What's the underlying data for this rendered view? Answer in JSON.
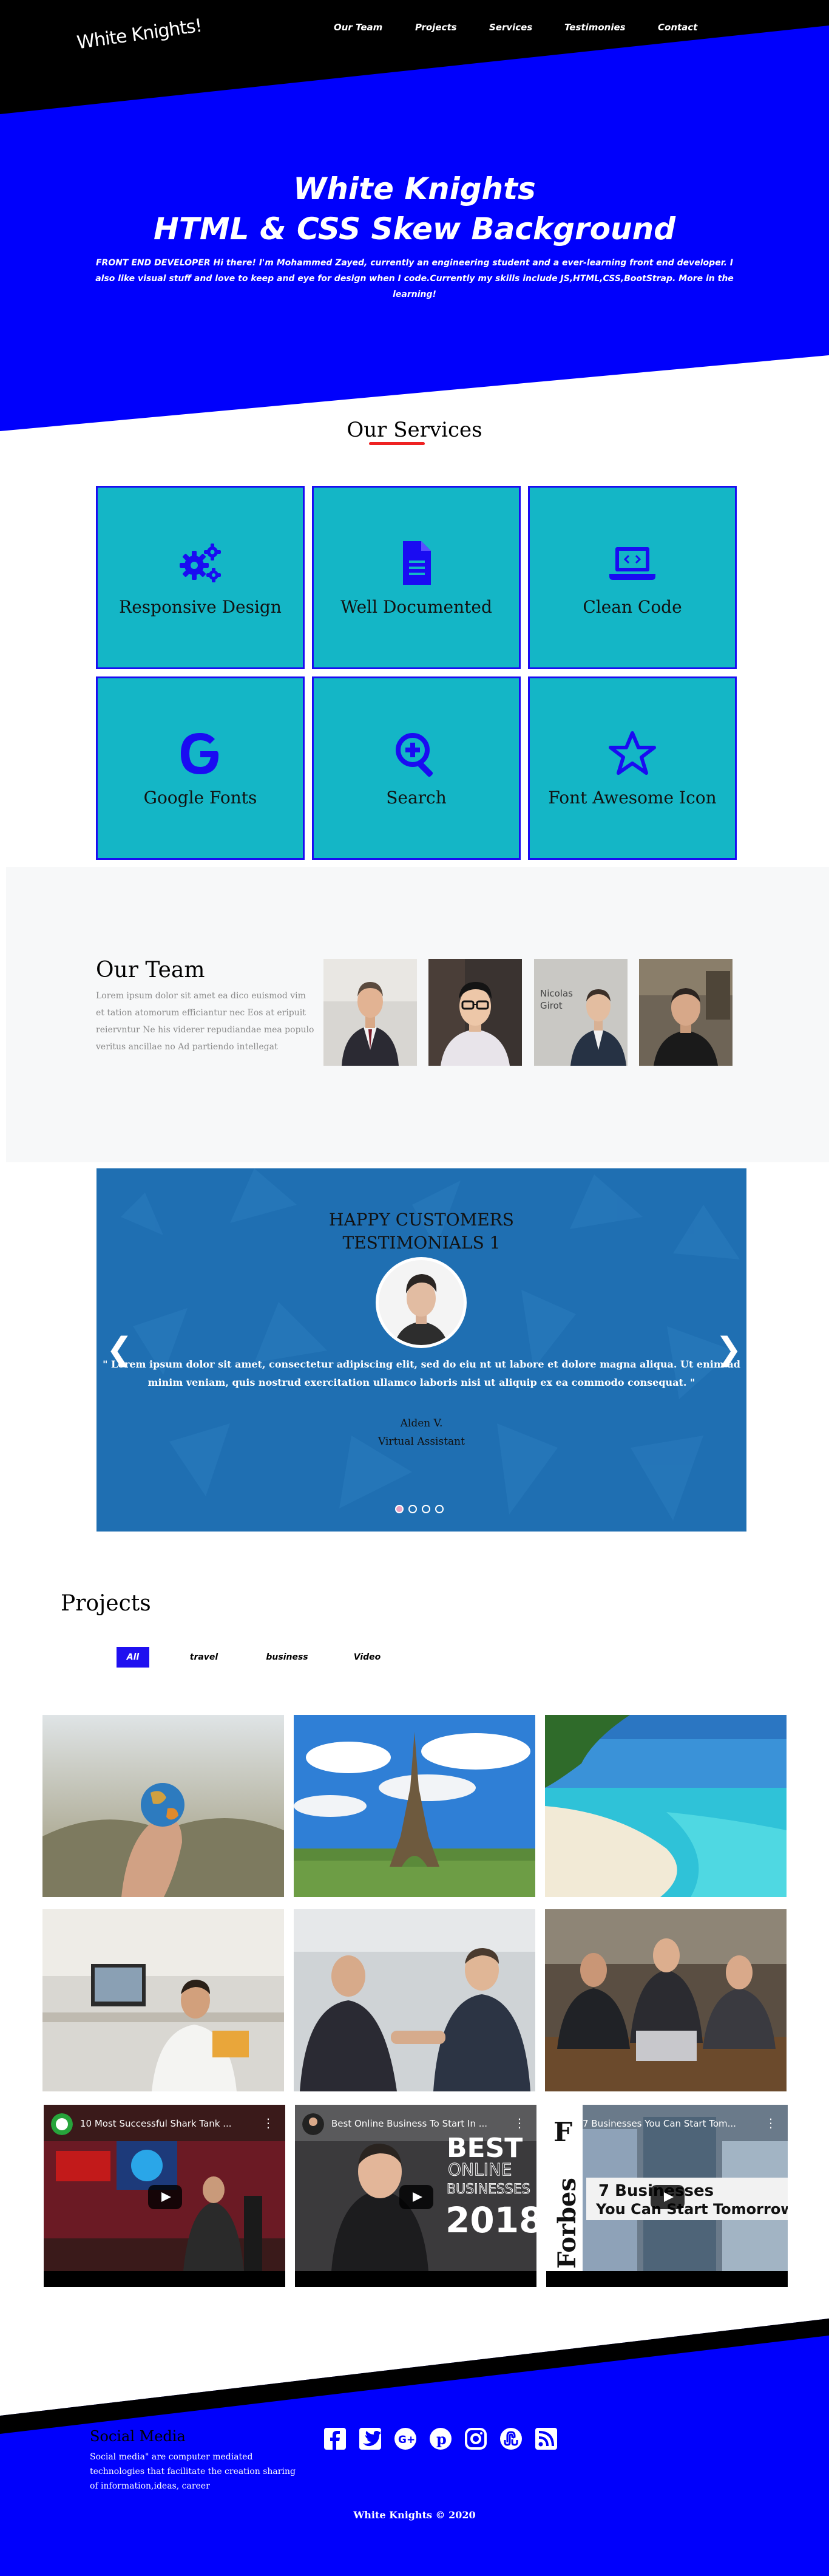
{
  "logo": "White Knights!",
  "nav": [
    "Our Team",
    "Projects",
    "Services",
    "Testimonies",
    "Contact"
  ],
  "hero": {
    "title": "White Knights",
    "subtitle": "HTML & CSS Skew Background",
    "description": "FRONT END DEVELOPER Hi there! I'm Mohammed Zayed, currently an engineering student and a ever-learning front end developer. I also like visual stuff and love to keep and eye for design when I code.Currently my skills include JS,HTML,CSS,BootStrap. More in the learning!"
  },
  "services": {
    "title": "Our Services",
    "items": [
      {
        "label": "Responsive Design",
        "icon": "cogs-icon"
      },
      {
        "label": "Well Documented",
        "icon": "file-icon"
      },
      {
        "label": "Clean Code",
        "icon": "laptop-code-icon"
      },
      {
        "label": "Google Fonts",
        "icon": "google-icon"
      },
      {
        "label": "Search",
        "icon": "search-plus-icon"
      },
      {
        "label": "Font Awesome Icon",
        "icon": "star-icon"
      }
    ],
    "accent": "#1a0cf2",
    "card_color": "#14b6c6"
  },
  "team": {
    "title": "Our Team",
    "text": "Lorem ipsum dolor sit amet ea dico euismod vim et tation atomorum efficiantur nec Eos at eripuit reiervntur Ne his viderer repudiandae mea populo veritus ancillae no Ad partiendo intellegat",
    "photo4_caption_1": "Nicolas",
    "photo4_caption_2": "Girot"
  },
  "testimonials": {
    "heading_1": "HAPPY CUSTOMERS",
    "heading_2": "TESTIMONIALS 1",
    "quote": "\" Lorem ipsum dolor sit amet, consectetur adipiscing elit, sed do eiu nt ut labore et dolore magna aliqua. Ut enim ad minim veniam, quis nostrud exercitation ullamco laboris nisi ut aliquip ex ea commodo consequat. \"",
    "name": "Alden V.",
    "role": "Virtual Assistant",
    "prev": "❮",
    "next": "❯",
    "slides": 4,
    "active_slide": 1
  },
  "projects": {
    "title": "Projects",
    "filters": [
      "All",
      "travel",
      "business",
      "Video"
    ],
    "active_filter": "All",
    "videos": [
      {
        "title": "10 Most Successful Shark Tank ..."
      },
      {
        "title": "Best Online Business To Start In ...",
        "overlay_1": "BEST",
        "overlay_2": "ONLINE",
        "overlay_3": "BUSINESSES",
        "overlay_4": "2018"
      },
      {
        "title": "7 Businesses You Can Start Tom...",
        "overlay_1": "7 Businesses",
        "overlay_2": "You Can Start Tomorrow",
        "brand": "Forbes"
      }
    ]
  },
  "footer": {
    "heading": "Social Media",
    "text": "Social media\" are computer mediated technologies that facilitate the creation sharing of information,ideas, career",
    "social": [
      "facebook-icon",
      "twitter-icon",
      "google-plus-icon",
      "pinterest-icon",
      "instagram-icon",
      "stumbleupon-icon",
      "rss-icon"
    ],
    "copyright": "White Knights © 2020"
  }
}
